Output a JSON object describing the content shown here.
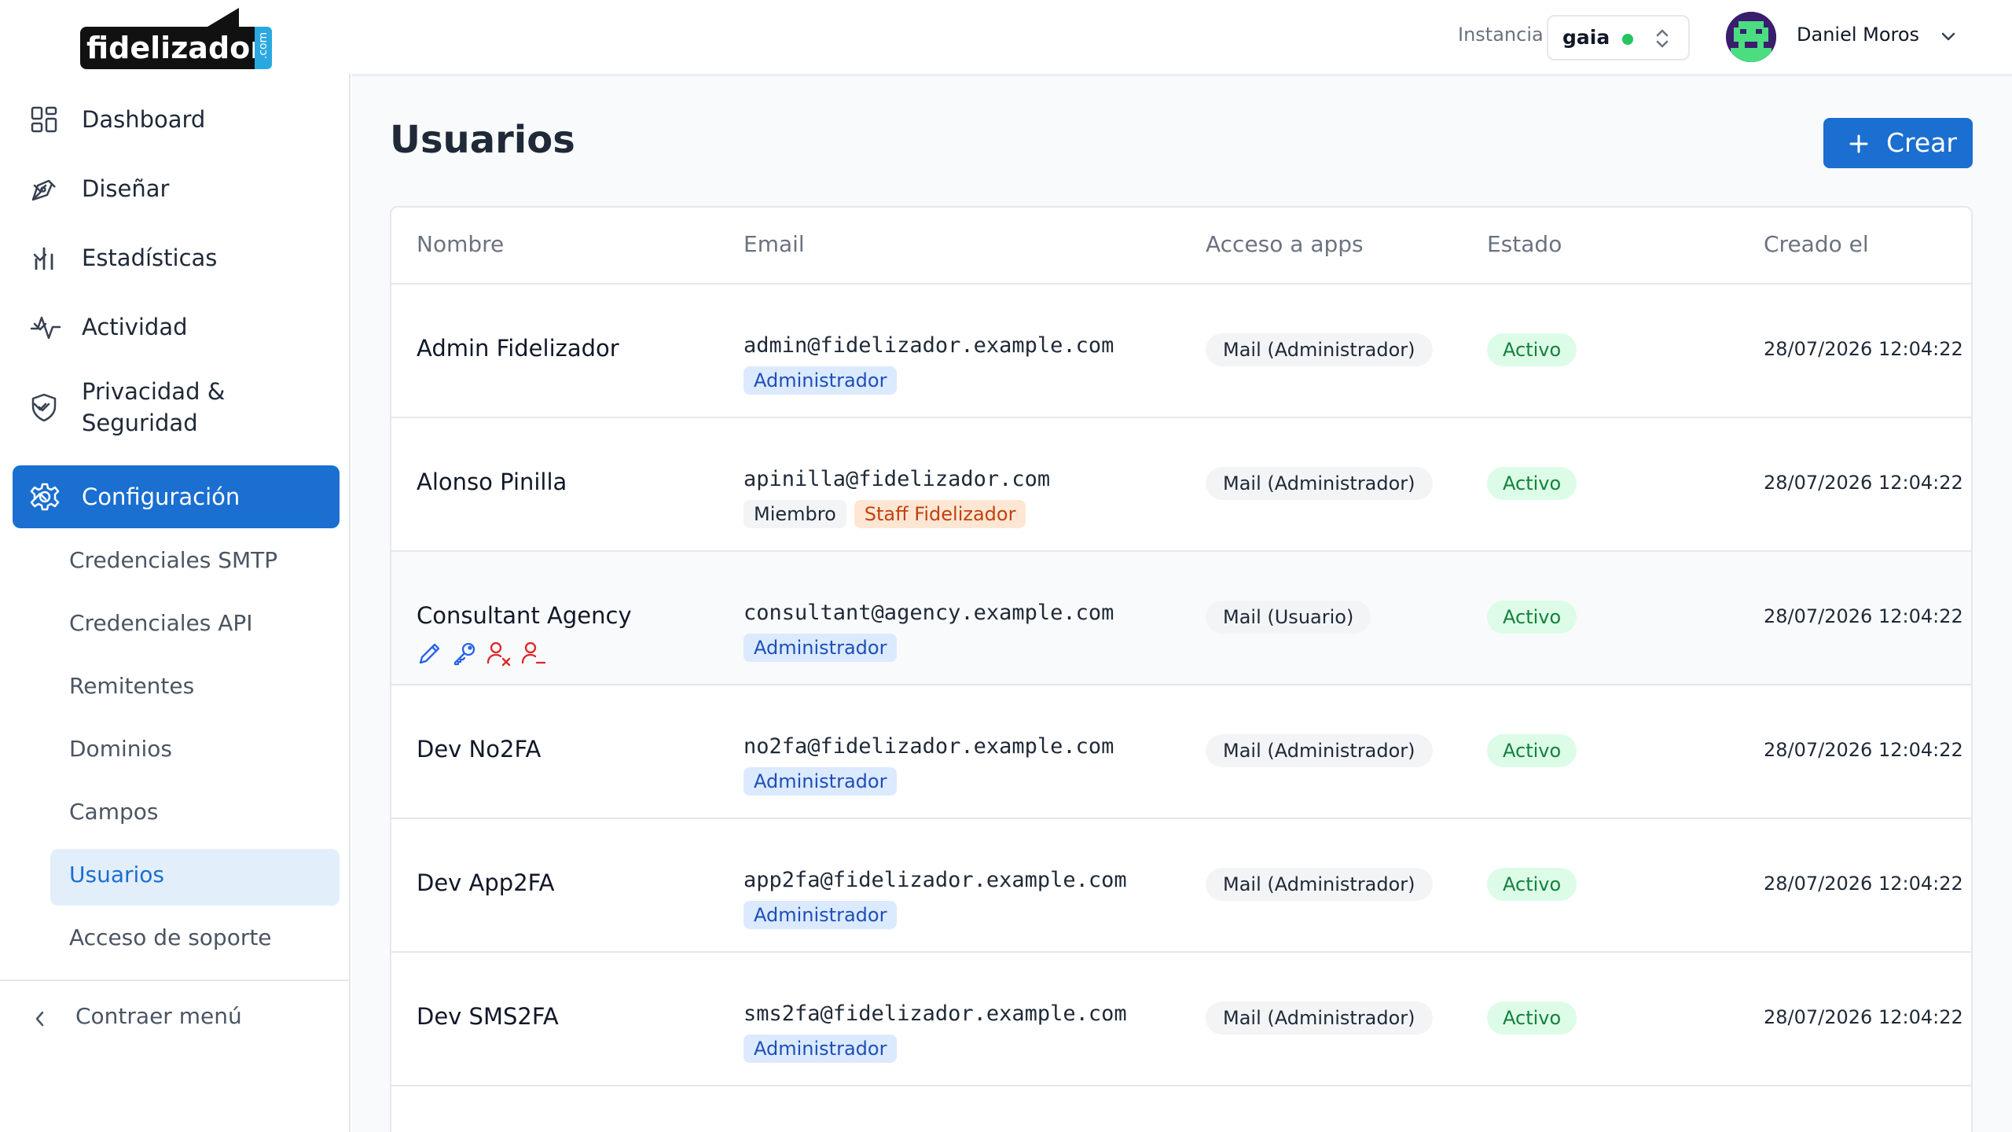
{
  "app": {
    "logo_text": "fidelizador",
    "logo_suffix": ".com"
  },
  "topbar": {
    "instancia_label": "Instancia",
    "instancia_value": "gaia",
    "user_name": "Daniel Moros"
  },
  "sidebar": {
    "items": [
      {
        "label": "Dashboard",
        "icon": "dashboard-icon"
      },
      {
        "label": "Diseñar",
        "icon": "pen-icon"
      },
      {
        "label": "Estadísticas",
        "icon": "bar-chart-icon"
      },
      {
        "label": "Actividad",
        "icon": "activity-icon"
      },
      {
        "label": "Privacidad & Seguridad",
        "icon": "shield-icon"
      },
      {
        "label": "Configuración",
        "icon": "gear-icon"
      }
    ],
    "subitems": [
      {
        "label": "Credenciales SMTP"
      },
      {
        "label": "Credenciales API"
      },
      {
        "label": "Remitentes"
      },
      {
        "label": "Dominios"
      },
      {
        "label": "Campos"
      },
      {
        "label": "Usuarios"
      },
      {
        "label": "Acceso de soporte"
      }
    ],
    "collapse_label": "Contraer menú"
  },
  "main": {
    "title": "Usuarios",
    "create_label": "Crear",
    "columns": [
      "Nombre",
      "Email",
      "Acceso a apps",
      "Estado",
      "Creado el"
    ],
    "rows": [
      {
        "name": "Admin Fidelizador",
        "email": "admin@fidelizador.example.com",
        "role": "Administrador",
        "app": "Mail (Administrador)",
        "status": "Activo",
        "created": "28/07/2026 12:04:22"
      },
      {
        "name": "Alonso Pinilla",
        "email": "apinilla@fidelizador.com",
        "role": "Miembro",
        "extra_badge": "Staff Fidelizador",
        "app": "Mail (Administrador)",
        "status": "Activo",
        "created": "28/07/2026 12:04:22"
      },
      {
        "name": "Consultant Agency",
        "email": "consultant@agency.example.com",
        "role": "Administrador",
        "app": "Mail (Usuario)",
        "status": "Activo",
        "created": "28/07/2026 12:04:22"
      },
      {
        "name": "Dev No2FA",
        "email": "no2fa@fidelizador.example.com",
        "role": "Administrador",
        "app": "Mail (Administrador)",
        "status": "Activo",
        "created": "28/07/2026 12:04:22"
      },
      {
        "name": "Dev App2FA",
        "email": "app2fa@fidelizador.example.com",
        "role": "Administrador",
        "app": "Mail (Administrador)",
        "status": "Activo",
        "created": "28/07/2026 12:04:22"
      },
      {
        "name": "Dev SMS2FA",
        "email": "sms2fa@fidelizador.example.com",
        "role": "Administrador",
        "app": "Mail (Administrador)",
        "status": "Activo",
        "created": "28/07/2026 12:04:22"
      }
    ]
  },
  "colors": {
    "accent": "#1a6fd0",
    "active_sub_bg": "#e3eefb",
    "status_green": "#15803d",
    "danger_red": "#dc2626"
  }
}
